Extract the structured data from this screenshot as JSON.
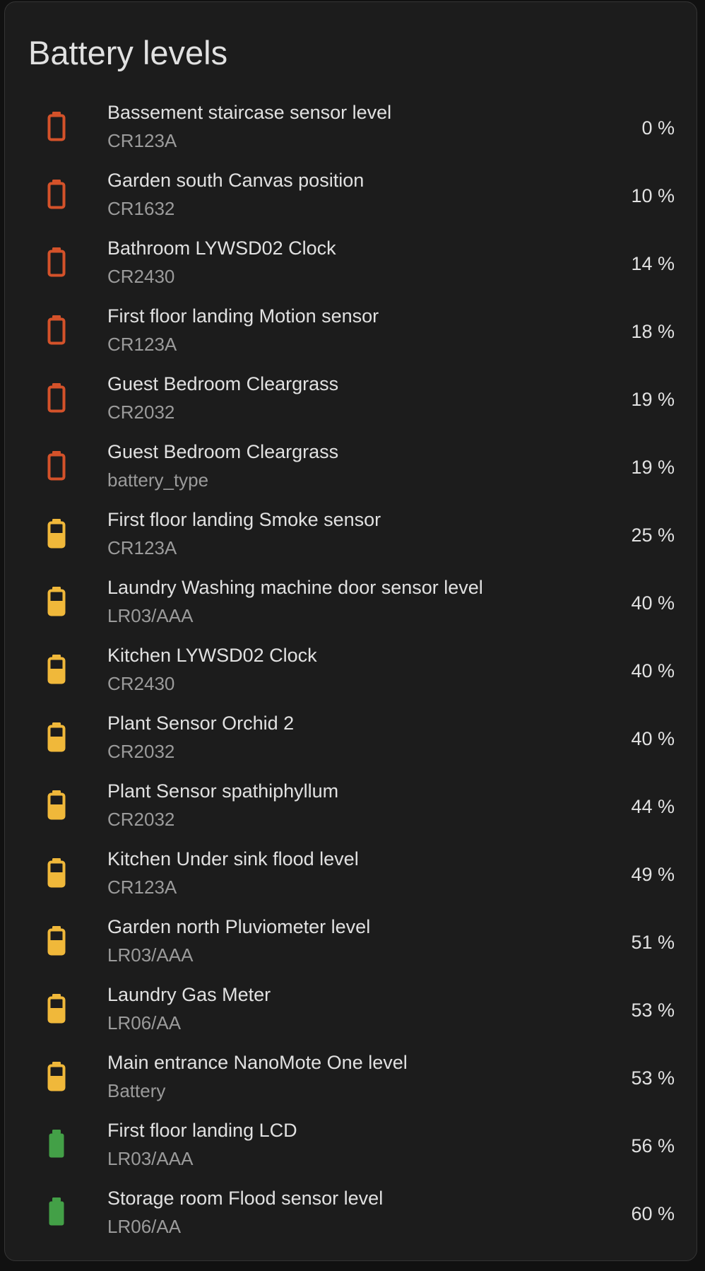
{
  "card": {
    "title": "Battery levels"
  },
  "colors": {
    "low": "#d4522a",
    "medium": "#f0b83a",
    "high": "#43a047"
  },
  "items": [
    {
      "name": "Bassement staircase sensor level",
      "type": "CR123A",
      "level": "0 %",
      "status": "low",
      "icon": "battery-low-icon"
    },
    {
      "name": "Garden south Canvas position",
      "type": "CR1632",
      "level": "10 %",
      "status": "low",
      "icon": "battery-low-icon"
    },
    {
      "name": "Bathroom LYWSD02 Clock",
      "type": "CR2430",
      "level": "14 %",
      "status": "low",
      "icon": "battery-low-icon"
    },
    {
      "name": "First floor landing Motion sensor",
      "type": "CR123A",
      "level": "18 %",
      "status": "low",
      "icon": "battery-low-icon"
    },
    {
      "name": "Guest Bedroom Cleargrass",
      "type": "CR2032",
      "level": "19 %",
      "status": "low",
      "icon": "battery-low-icon"
    },
    {
      "name": "Guest Bedroom Cleargrass",
      "type": "battery_type",
      "level": "19 %",
      "status": "low",
      "icon": "battery-low-icon"
    },
    {
      "name": "First floor landing Smoke sensor",
      "type": "CR123A",
      "level": "25 %",
      "status": "medium",
      "icon": "battery-medium-icon"
    },
    {
      "name": "Laundry Washing machine door sensor level",
      "type": "LR03/AAA",
      "level": "40 %",
      "status": "medium",
      "icon": "battery-medium-icon"
    },
    {
      "name": "Kitchen LYWSD02 Clock",
      "type": "CR2430",
      "level": "40 %",
      "status": "medium",
      "icon": "battery-medium-icon"
    },
    {
      "name": "Plant Sensor Orchid 2",
      "type": "CR2032",
      "level": "40 %",
      "status": "medium",
      "icon": "battery-medium-icon"
    },
    {
      "name": "Plant Sensor spathiphyllum",
      "type": "CR2032",
      "level": "44 %",
      "status": "medium",
      "icon": "battery-medium-icon"
    },
    {
      "name": "Kitchen Under sink flood level",
      "type": "CR123A",
      "level": "49 %",
      "status": "medium",
      "icon": "battery-medium-icon"
    },
    {
      "name": "Garden north Pluviometer level",
      "type": "LR03/AAA",
      "level": "51 %",
      "status": "medium",
      "icon": "battery-medium-icon"
    },
    {
      "name": "Laundry Gas Meter",
      "type": "LR06/AA",
      "level": "53 %",
      "status": "medium",
      "icon": "battery-medium-icon"
    },
    {
      "name": "Main entrance NanoMote One level",
      "type": "Battery",
      "level": "53 %",
      "status": "medium",
      "icon": "battery-medium-icon"
    },
    {
      "name": "First floor landing LCD",
      "type": "LR03/AAA",
      "level": "56 %",
      "status": "high",
      "icon": "battery-high-icon"
    },
    {
      "name": "Storage room Flood sensor level",
      "type": "LR06/AA",
      "level": "60 %",
      "status": "high",
      "icon": "battery-high-icon"
    }
  ]
}
